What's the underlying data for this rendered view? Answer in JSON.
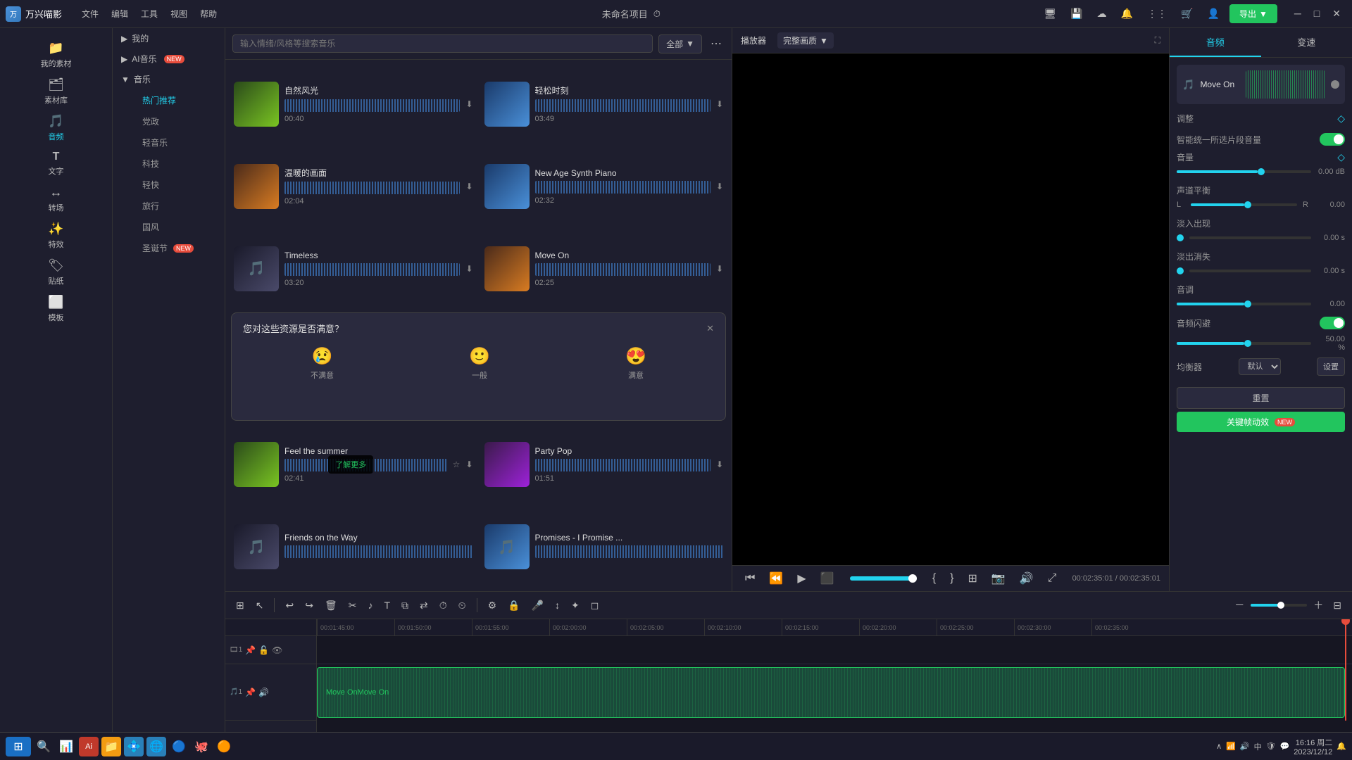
{
  "app": {
    "title": "万兴喵影",
    "project_name": "未命名项目"
  },
  "titlebar": {
    "menu": [
      "文件",
      "编辑",
      "工具",
      "视图",
      "帮助"
    ],
    "export_label": "导出",
    "win_controls": [
      "─",
      "□",
      "✕"
    ]
  },
  "toolbar": {
    "items": [
      {
        "label": "我的素材",
        "icon": "📁"
      },
      {
        "label": "素材库",
        "icon": "🗂"
      },
      {
        "label": "音频",
        "icon": "🎵",
        "active": true
      },
      {
        "label": "文字",
        "icon": "T"
      },
      {
        "label": "转场",
        "icon": "↔"
      },
      {
        "label": "特效",
        "icon": "✨"
      },
      {
        "label": "贴纸",
        "icon": "🏷"
      },
      {
        "label": "模板",
        "icon": "⬜"
      }
    ]
  },
  "sidebar": {
    "items": [
      {
        "label": "我的",
        "icon": "👤",
        "expandable": true
      },
      {
        "label": "AI音乐",
        "icon": "🤖",
        "badge": "NEW",
        "expandable": true
      },
      {
        "label": "音乐",
        "icon": "🎵",
        "expandable": true,
        "active": true
      }
    ],
    "music_sub": [
      {
        "label": "热门推荐",
        "active": true
      },
      {
        "label": "党政"
      },
      {
        "label": "轻音乐"
      },
      {
        "label": "科技"
      },
      {
        "label": "轻快"
      },
      {
        "label": "旅行"
      },
      {
        "label": "国风"
      },
      {
        "label": "圣诞节",
        "badge": "NEW"
      }
    ]
  },
  "music_panel": {
    "search_placeholder": "输入情绪/风格等搜索音乐",
    "filter_label": "全部",
    "songs": [
      {
        "id": 1,
        "title": "自然风光",
        "duration": "00:40",
        "thumb_class": "thumb-nature",
        "col": 0
      },
      {
        "id": 2,
        "title": "轻松时刻",
        "duration": "03:49",
        "thumb_class": "thumb-blue",
        "col": 1
      },
      {
        "id": 3,
        "title": "温暖的画面",
        "duration": "02:04",
        "thumb_class": "thumb-orange",
        "col": 0
      },
      {
        "id": 4,
        "title": "New Age Synth Piano",
        "duration": "02:32",
        "thumb_class": "thumb-blue",
        "col": 1
      },
      {
        "id": 5,
        "title": "Timeless",
        "duration": "03:20",
        "thumb_class": "thumb-dark",
        "col": 0
      },
      {
        "id": 6,
        "title": "Move On",
        "duration": "02:25",
        "thumb_class": "thumb-orange",
        "col": 1
      }
    ],
    "songs_row2": [
      {
        "id": 7,
        "title": "Feel the summer",
        "duration": "02:41",
        "thumb_class": "thumb-nature",
        "col": 0,
        "tooltip": "了解更多"
      },
      {
        "id": 8,
        "title": "Party Pop",
        "duration": "01:51",
        "thumb_class": "thumb-purple",
        "col": 1
      },
      {
        "id": 9,
        "title": "Friends on the Way",
        "duration": "",
        "thumb_class": "thumb-dark",
        "col": 0
      },
      {
        "id": 10,
        "title": "Promises - I Promise ...",
        "duration": "",
        "thumb_class": "thumb-blue",
        "col": 1
      }
    ],
    "feedback": {
      "title": "您对这些资源是否满意？",
      "options": [
        {
          "emoji": "😢",
          "label": "不满意"
        },
        {
          "emoji": "🙂",
          "label": "一般"
        },
        {
          "emoji": "😍",
          "label": "满意"
        }
      ]
    }
  },
  "preview": {
    "label": "播放器",
    "quality": "完整画质",
    "time_current": "00:02:35:01",
    "time_total": "00:02:35:01",
    "progress_pct": 100
  },
  "right_panel": {
    "tabs": [
      "音频",
      "变速"
    ],
    "active_tab": "音频",
    "track_name": "Move On",
    "sections": {
      "adjust_label": "调整",
      "smart_vol_label": "智能统一所选片段音量",
      "volume_label": "音量",
      "volume_value": "0.00",
      "volume_unit": "dB",
      "balance_label": "声道平衡",
      "balance_l": "L",
      "balance_r": "R",
      "balance_value": "0.00",
      "fade_in_label": "淡入出现",
      "fade_in_value": "0.00",
      "fade_in_unit": "s",
      "fade_out_label": "淡出消失",
      "fade_out_value": "0.00",
      "fade_out_unit": "s",
      "pitch_label": "音调",
      "pitch_value": "0.00",
      "flash_label": "音频闪避",
      "flash_value": "50.00",
      "flash_unit": "%",
      "eq_label": "均衡器",
      "eq_default": "默认",
      "eq_setting": "设置",
      "reset_btn": "重置",
      "keybind_btn": "关键帧动效",
      "keybind_badge": "NEW"
    }
  },
  "timeline": {
    "ruler_marks": [
      "00:01:45:00",
      "00:01:50:00",
      "00:01:55:00",
      "00:02:00:00",
      "00:02:05:00",
      "00:02:10:00",
      "00:02:15:00",
      "00:02:20:00",
      "00:02:25:00",
      "00:02:30:00",
      "00:02:35:00"
    ],
    "audio_track_label": "Move On",
    "playhead_pct": 98
  },
  "taskbar": {
    "time": "16:16 周二",
    "date": "2023/12/12",
    "ime": "中",
    "apps": [
      "🪟",
      "🔍",
      "📊",
      "🎨",
      "📁",
      "🌐",
      "🔵",
      "🐙",
      "🟠"
    ]
  }
}
